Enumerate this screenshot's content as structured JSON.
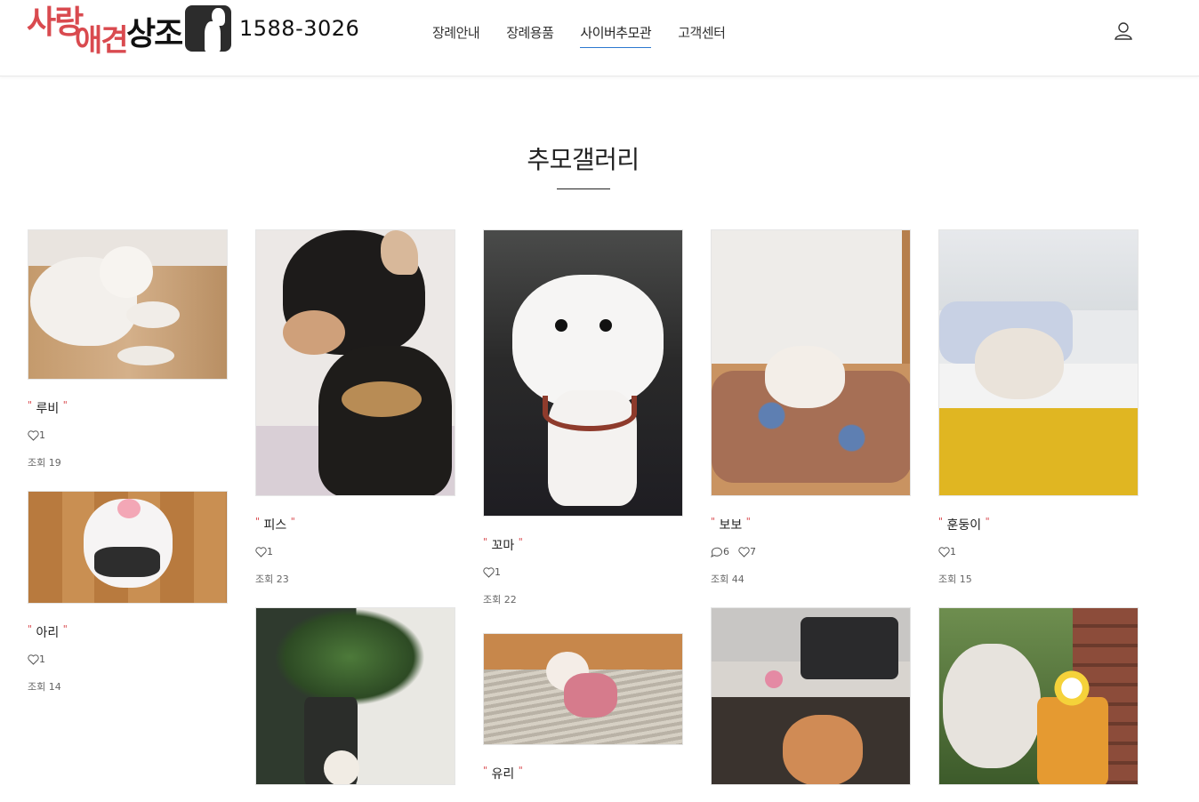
{
  "header": {
    "logo_part1": "사랑",
    "logo_part2": "애견",
    "logo_part3": "상조",
    "phone": "1588-3026",
    "nav": [
      "장례안내",
      "장례용품",
      "사이버추모관",
      "고객센터"
    ],
    "active_nav": "사이버추모관"
  },
  "page": {
    "title": "추모갤러리"
  },
  "gallery": [
    {
      "name": "루비",
      "likes": "1",
      "views_label": "조회",
      "views": "19"
    },
    {
      "name": "아리",
      "likes": "1",
      "views_label": "조회",
      "views": "14"
    },
    {
      "name": "피스",
      "likes": "1",
      "views_label": "조회",
      "views": "23"
    },
    {
      "name": "꼬마",
      "likes": "1",
      "views_label": "조회",
      "views": "22"
    },
    {
      "name": "유리",
      "likes": "",
      "views_label": "",
      "views": ""
    },
    {
      "name": "보보",
      "comments": "6",
      "likes": "7",
      "views_label": "조회",
      "views": "44"
    },
    {
      "name": "훈둥이",
      "likes": "1",
      "views_label": "조회",
      "views": "15"
    }
  ],
  "colors": {
    "brand_red": "#d94a4f",
    "nav_active_underline": "#2b78d0",
    "text": "#222222"
  },
  "icons": [
    "user-icon",
    "heart-icon",
    "comment-icon"
  ]
}
